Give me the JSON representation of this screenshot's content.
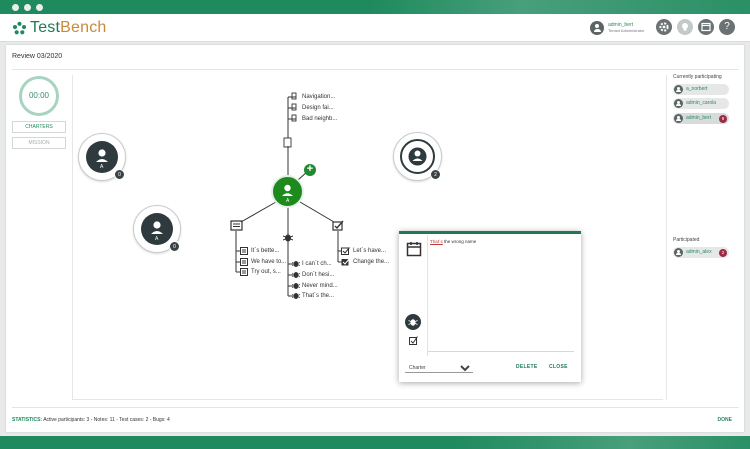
{
  "app": {
    "brand_part1": "Test",
    "brand_part2": "Bench",
    "accent_color": "#1f8a5e",
    "brand_secondary_color": "#c98a3a"
  },
  "header": {
    "user_name": "admin_bert",
    "user_role": "Tenant Administrator",
    "icons": [
      "gear-icon",
      "lightbulb-icon",
      "calendar-icon",
      "help-icon"
    ],
    "help_glyph": "?"
  },
  "review": {
    "title": "Review 03/2020",
    "timer": "00:00",
    "tabs": {
      "charters": "CHARTERS",
      "mission": "MISSION"
    }
  },
  "map": {
    "center_label": "A",
    "participants": [
      {
        "letter": "A",
        "count": "0"
      },
      {
        "letter": "A",
        "count": "0"
      },
      {
        "letter": "",
        "count": "2"
      }
    ],
    "test_cases": [
      "Navigation...",
      "Design fai...",
      "Bad neighb..."
    ],
    "notes": [
      "It´s bette...",
      "We have to...",
      "Try out, s..."
    ],
    "bugs": [
      "I can´t ch...",
      "Don´t hesi...",
      "Never mind...",
      "That´s the..."
    ],
    "checks": [
      "Let´s have...",
      "Change the..."
    ]
  },
  "sidebar": {
    "currently_title": "Currently participating",
    "currently": [
      {
        "name": "a_norbert",
        "badge": ""
      },
      {
        "name": "admin_carola",
        "badge": ""
      },
      {
        "name": "admin_bert",
        "badge": "9"
      }
    ],
    "participated_title": "Participated",
    "participated": [
      {
        "name": "admin_alex",
        "badge": "2"
      }
    ]
  },
  "popup": {
    "note_prefix": "That´s",
    "note_rest": " the wrong name",
    "select_value": "Charter",
    "delete_label": "DELETE",
    "close_label": "CLOSE"
  },
  "footer": {
    "stats_label": "STATISTICS:",
    "stats_text": " Active participants: 3 - Notes: 11 - Test cases: 2 - Bugs: 4",
    "done_label": "DONE"
  }
}
